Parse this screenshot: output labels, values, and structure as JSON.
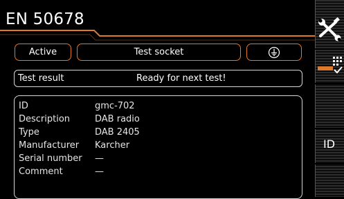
{
  "header": {
    "title": "EN 50678"
  },
  "controls": {
    "mode_label": "Active",
    "connection_label": "Test socket",
    "ground_icon": "protective-earth-icon"
  },
  "result": {
    "label": "Test result",
    "status": "Ready for next test!"
  },
  "device": {
    "rows": [
      {
        "key": "ID",
        "value": "gmc-702"
      },
      {
        "key": "Description",
        "value": "DAB radio"
      },
      {
        "key": "Type",
        "value": "DAB 2405"
      },
      {
        "key": "Manufacturer",
        "value": "Karcher"
      },
      {
        "key": "Serial number",
        "value": "—"
      },
      {
        "key": "Comment",
        "value": "—"
      }
    ]
  },
  "sidebar": {
    "tools_icon": "tools-icon",
    "list_icon": "checklist-icon",
    "id_label": "ID"
  },
  "colors": {
    "accent": "#e07a2b",
    "border": "#d8d8d8",
    "background": "#000000"
  }
}
